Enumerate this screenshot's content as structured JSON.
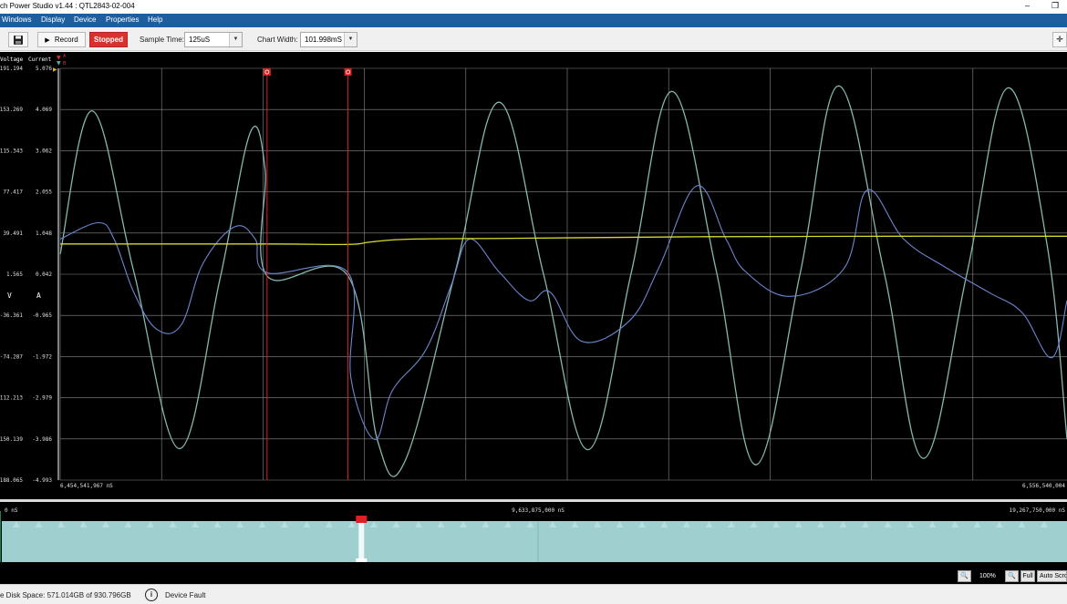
{
  "window": {
    "title": "ch Power Studio v1.44 : QTL2843-02-004",
    "minimize_glyph": "–",
    "restore_glyph": "❐"
  },
  "menu": {
    "items": [
      "Windows",
      "Display",
      "Device",
      "Properties",
      "Help"
    ]
  },
  "toolbar": {
    "save_icon": "floppy-disk-icon",
    "record_label": "Record",
    "stopped_label": "Stopped",
    "sample_time_label": "Sample Time:",
    "sample_time_value": "125uS",
    "chart_width_label": "Chart Width:",
    "chart_width_value": "101.998mS",
    "pin_icon": "pin-icon"
  },
  "chart": {
    "voltage_header": "Voltage",
    "current_header": "Current",
    "voltage_unit": "V",
    "current_unit": "A",
    "marker_a": "A",
    "marker_b": "B",
    "x_start_label": "6,454,541,967 nS",
    "x_end_label": "6,556,540,004",
    "voltage_ticks": [
      "191.194",
      "153.269",
      "115.343",
      "77.417",
      "39.491",
      "1.565",
      "-36.361",
      "-74.287",
      "-112.213",
      "-150.139",
      "-188.065"
    ],
    "current_ticks": [
      "5.076",
      "4.069",
      "3.062",
      "2.055",
      "1.048",
      "0.042",
      "-0.965",
      "-1.972",
      "-2.979",
      "-3.986",
      "-4.993"
    ],
    "colors": {
      "voltage": "#86b7b0",
      "current": "#6c86cf",
      "power": "#d9d92a",
      "cursor": "#e02020",
      "grid": "#8a8a8a"
    }
  },
  "chart_data": {
    "type": "line",
    "title": "",
    "xlabel": "",
    "ylabel": "Voltage / Current",
    "x_range_ns": [
      6454541967,
      6556540004
    ],
    "ylim_voltage": [
      -188.065,
      191.194
    ],
    "ylim_current": [
      -4.993,
      5.076
    ],
    "grid": true,
    "cursors_ns": [
      6475500000,
      6483700000
    ],
    "series": [
      {
        "name": "",
        "axis": "voltage",
        "color": "#86b7b0",
        "x_ns": [
          6454541967,
          6457800000,
          6462000000,
          6466600000,
          6470700000,
          6473800000,
          6475300000,
          6475500000,
          6483700000,
          6486700000,
          6489500000,
          6494600000,
          6499000000,
          6503500000,
          6508000000,
          6512400000,
          6516500000,
          6521000000,
          6525000000,
          6529500000,
          6533400000,
          6538000000,
          6542000000,
          6546400000,
          6550500000,
          6554500000,
          6556540004
        ],
        "values": [
          20,
          152,
          4,
          -159,
          -4,
          132,
          98,
          0,
          0,
          -152,
          -170,
          5,
          160,
          2,
          -160,
          3,
          170,
          5,
          -174,
          2,
          175,
          4,
          -168,
          2,
          173,
          30,
          -150
        ]
      },
      {
        "name": "",
        "axis": "current",
        "color": "#6c86cf",
        "x_ns": [
          6454541967,
          6458400000,
          6460000000,
          6462000000,
          6464300000,
          6466800000,
          6469000000,
          6472200000,
          6474300000,
          6475500000,
          6483700000,
          6484000000,
          6486400000,
          6488200000,
          6491600000,
          6494200000,
          6496000000,
          6499000000,
          6502000000,
          6504200000,
          6507400000,
          6512200000,
          6515200000,
          6519000000,
          6522000000,
          6524000000,
          6528500000,
          6534000000,
          6536300000,
          6540000000,
          6544300000,
          6548600000,
          6552000000,
          6555000000,
          6556540004
        ],
        "values": [
          0.9,
          1.3,
          0.9,
          -0.4,
          -1.3,
          -1.2,
          0.3,
          1.2,
          0.9,
          0.08,
          0.08,
          -2.5,
          -4.0,
          -2.8,
          -1.8,
          -0.2,
          0.9,
          0.1,
          -0.6,
          -0.4,
          -1.6,
          -1.1,
          0.2,
          2.2,
          0.9,
          0.1,
          -0.5,
          0.2,
          2.1,
          0.9,
          0.2,
          -0.4,
          -0.9,
          -2.0,
          -0.6
        ]
      },
      {
        "name": "",
        "axis": "current",
        "color": "#d9d92a",
        "x_ns": [
          6454541967,
          6475500000,
          6483700000,
          6486000000,
          6490000000,
          6500000000,
          6520000000,
          6540000000,
          6556540004
        ],
        "values": [
          0.78,
          0.78,
          0.77,
          0.83,
          0.9,
          0.92,
          0.96,
          0.97,
          0.97
        ]
      }
    ]
  },
  "overview": {
    "left_label": "0 nS",
    "mid_label": "9,633,875,000 nS",
    "right_label": "19,267,750,000 nS",
    "window_position": 0.335
  },
  "zoom": {
    "zoom_out_icon": "zoom-out-icon",
    "zoom_level": "100%",
    "zoom_in_icon": "zoom-in-icon",
    "full_label": "Full",
    "auto_scroll_label": "Auto Scroll"
  },
  "status": {
    "disk_space": "e Disk Space: 571.014GB of 930.796GB",
    "device_fault": "Device Fault"
  }
}
